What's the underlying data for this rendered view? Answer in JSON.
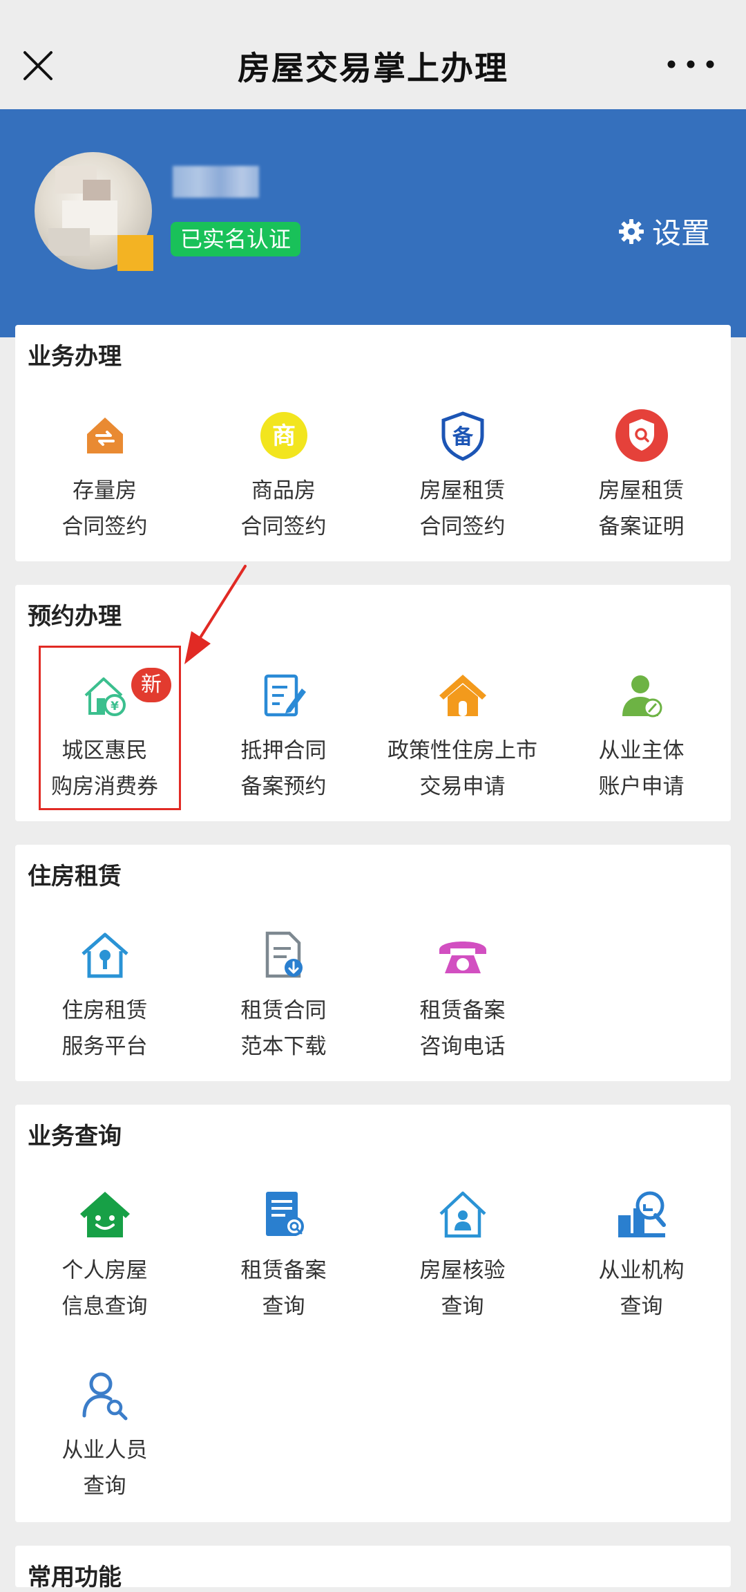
{
  "topbar": {
    "title": "房屋交易掌上办理"
  },
  "profile": {
    "verified_label": "已实名认证",
    "settings_label": "设置"
  },
  "sections": {
    "business": {
      "title": "业务办理",
      "items": [
        {
          "line1": "存量房",
          "line2": "合同签约",
          "icon": "house-exchange-icon"
        },
        {
          "line1": "商品房",
          "line2": "合同签约",
          "icon": "shang-icon"
        },
        {
          "line1": "房屋租赁",
          "line2": "合同签约",
          "icon": "bei-shield-icon"
        },
        {
          "line1": "房屋租赁",
          "line2": "备案证明",
          "icon": "search-shield-icon"
        }
      ]
    },
    "appointment": {
      "title": "预约办理",
      "new_badge": "新",
      "items": [
        {
          "line1": "城区惠民",
          "line2": "购房消费券",
          "icon": "house-coupon-icon"
        },
        {
          "line1": "抵押合同",
          "line2": "备案预约",
          "icon": "document-edit-icon"
        },
        {
          "line1": "政策性住房上市",
          "line2": "交易申请",
          "icon": "orange-house-icon"
        },
        {
          "line1": "从业主体",
          "line2": "账户申请",
          "icon": "user-edit-icon"
        }
      ]
    },
    "rental": {
      "title": "住房租赁",
      "items": [
        {
          "line1": "住房租赁",
          "line2": "服务平台",
          "icon": "house-lock-icon"
        },
        {
          "line1": "租赁合同",
          "line2": "范本下载",
          "icon": "document-download-icon"
        },
        {
          "line1": "租赁备案",
          "line2": "咨询电话",
          "icon": "telephone-icon"
        }
      ]
    },
    "query": {
      "title": "业务查询",
      "items": [
        {
          "line1": "个人房屋",
          "line2": "信息查询",
          "icon": "smiling-house-icon"
        },
        {
          "line1": "租赁备案",
          "line2": "查询",
          "icon": "document-search-icon"
        },
        {
          "line1": "房屋核验",
          "line2": "查询",
          "icon": "house-person-icon"
        },
        {
          "line1": "从业机构",
          "line2": "查询",
          "icon": "agency-search-icon"
        },
        {
          "line1": "从业人员",
          "line2": "查询",
          "icon": "person-search-icon"
        }
      ]
    },
    "common": {
      "title": "常用功能"
    }
  }
}
